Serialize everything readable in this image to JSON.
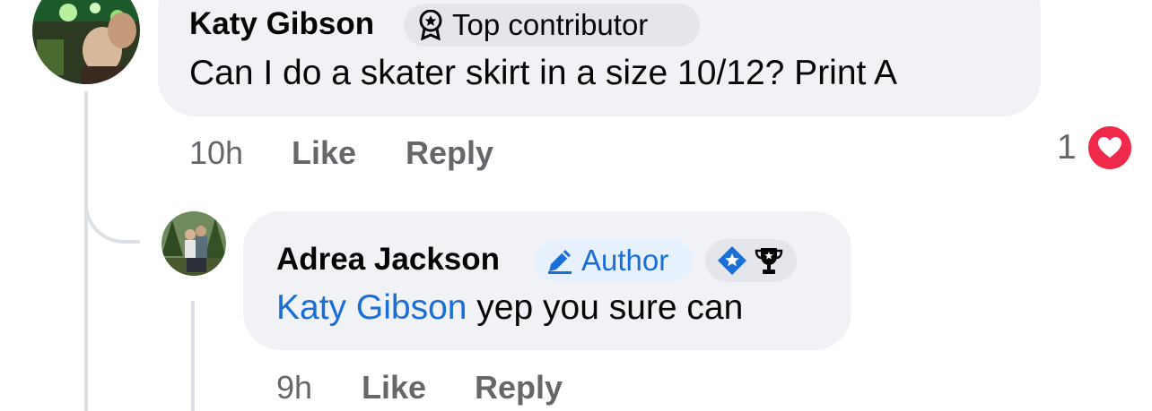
{
  "comment": {
    "author": "Katy Gibson",
    "badge": "Top contributor",
    "text": "Can I do a skater skirt in a size 10/12? Print A",
    "time": "10h",
    "like_label": "Like",
    "reply_label": "Reply",
    "reaction_count": "1",
    "reaction_icon": "heart-icon"
  },
  "reply": {
    "author": "Adrea Jackson",
    "author_badge": "Author",
    "mention": "Katy Gibson",
    "text": " yep you sure can",
    "time": "9h",
    "like_label": "Like",
    "reply_label": "Reply"
  },
  "colors": {
    "bubble": "#f0f2f5",
    "mention": "#1a6ed8",
    "meta": "#65676b",
    "heart": "#f0284a",
    "thread_line": "#dde0e5"
  }
}
